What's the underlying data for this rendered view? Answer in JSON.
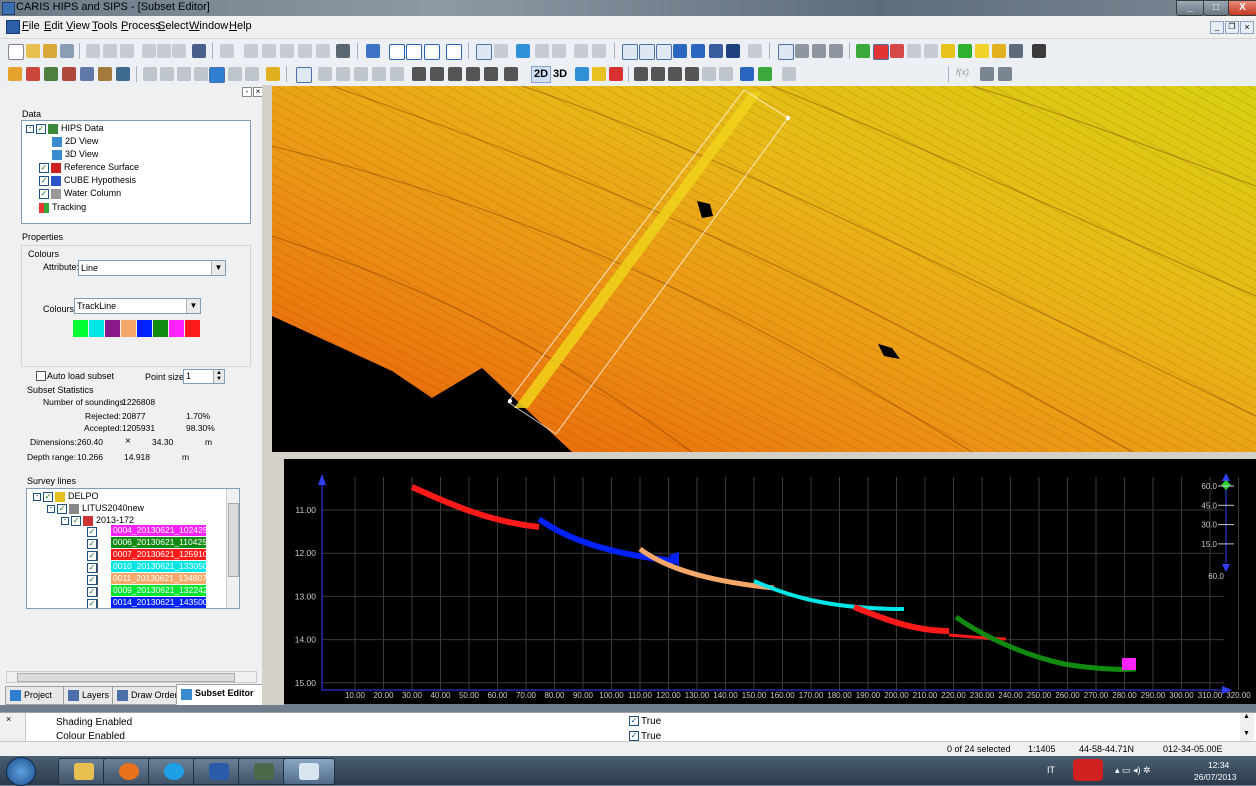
{
  "window": {
    "title": "CARIS HIPS and SIPS - [Subset Editor]",
    "min_label": "_",
    "max_label": "□",
    "close_label": "X",
    "mdi_min_label": "_",
    "mdi_restore_label": "❐",
    "mdi_close_label": "×"
  },
  "menu": {
    "items": [
      "File",
      "Edit",
      "View",
      "Tools",
      "Process",
      "Select",
      "Window",
      "Help"
    ]
  },
  "toolbar": {
    "mode_2d_label": "2D",
    "mode_3d_label": "3D",
    "fx_label": "f(x)"
  },
  "left_panel": {
    "data_section_label": "Data",
    "data_tree": [
      {
        "label": "HIPS Data",
        "checked": true
      },
      {
        "label": "2D View",
        "checked": false
      },
      {
        "label": "3D View",
        "checked": false
      },
      {
        "label": "Reference Surface",
        "checked": true
      },
      {
        "label": "CUBE Hypothesis",
        "checked": true
      },
      {
        "label": "Water Column",
        "checked": true
      },
      {
        "label": "Tracking",
        "checked": false
      }
    ],
    "properties_label": "Properties",
    "colours_group_label": "Colours",
    "attribute_label": "Attribute:",
    "attribute_value": "Line",
    "colours_label": "Colours:",
    "colours_value": "TrackLine",
    "palette": [
      "#00ff33",
      "#00e6e6",
      "#8a1a8a",
      "#f5a86a",
      "#0022ff",
      "#108a10",
      "#ff22ff",
      "#ff1a1a"
    ],
    "auto_load_label": "Auto load subset",
    "point_size_label": "Point size:",
    "point_size_value": "1",
    "subset_stats_label": "Subset Statistics",
    "num_soundings_label": "Number of soundings:",
    "num_soundings_value": "1226808",
    "rejected_label": "Rejected:",
    "rejected_value": "20877",
    "rejected_pct": "1.70%",
    "accepted_label": "Accepted:",
    "accepted_value": "1205931",
    "accepted_pct": "98.30%",
    "dimensions_label": "Dimensions:",
    "dimensions_w": "260.40",
    "dimensions_x": "×",
    "dimensions_h": "34.30",
    "dimensions_unit": "m",
    "depth_range_label": "Depth range:",
    "depth_min": "10.266",
    "depth_max": "14.918",
    "depth_unit": "m",
    "survey_lines_label": "Survey lines",
    "survey_root": "DELPO",
    "survey_vessel": "LITUS2040new",
    "survey_day": "2013-172",
    "survey_lines": [
      {
        "label": "0004_20130621_102425",
        "color": "#ff22ff"
      },
      {
        "label": "0006_20130621_110425",
        "color": "#108a10"
      },
      {
        "label": "0007_20130621_125910",
        "color": "#ff1a1a"
      },
      {
        "label": "0010_20130621_133050",
        "color": "#00e6e6"
      },
      {
        "label": "0011_20130621_134807",
        "color": "#f5a86a"
      },
      {
        "label": "0009_20130621_132242",
        "color": "#00e633"
      },
      {
        "label": "0014_20130621_143500",
        "color": "#0022ff"
      }
    ],
    "tabs": [
      "Project",
      "Layers",
      "Draw Order",
      "Subset Editor"
    ]
  },
  "profile_view": {
    "y_ticks": [
      "11.00",
      "12.00",
      "13.00",
      "14.00",
      "15.00"
    ],
    "x_ticks": [
      "10.00",
      "20.00",
      "30.00",
      "40.00",
      "50.00",
      "60.00",
      "70.00",
      "80.00",
      "90.00",
      "100.00",
      "110.00",
      "120.00",
      "130.00",
      "140.00",
      "150.00",
      "160.00",
      "170.00",
      "180.00",
      "190.00",
      "200.00",
      "210.00",
      "220.00",
      "230.00",
      "240.00",
      "250.00",
      "260.00",
      "270.00",
      "280.00",
      "290.00",
      "300.00",
      "310.00",
      "320.00"
    ],
    "angle_ticks": [
      "60.0",
      "45.0",
      "30.0",
      "15.0"
    ],
    "angle_value": "60.0"
  },
  "properties_grid": {
    "rows": [
      {
        "name": "Shading Enabled",
        "value": "True"
      },
      {
        "name": "Colour Enabled",
        "value": "True"
      }
    ]
  },
  "status": {
    "selected": "0 of 24 selected",
    "scale": "1:1405",
    "latitude": "44-58-44.71N",
    "longitude": "012-34-05.00E"
  },
  "taskbar": {
    "lang": "IT",
    "time": "12:34",
    "date": "26/07/2013"
  }
}
